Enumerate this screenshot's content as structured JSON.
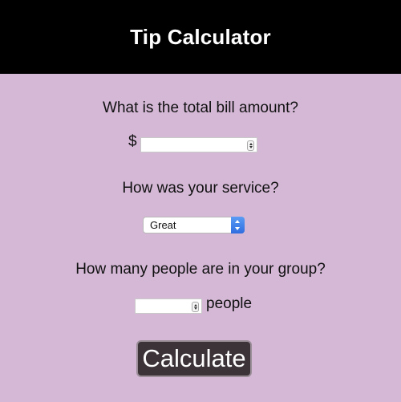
{
  "header": {
    "title": "Tip Calculator"
  },
  "bill": {
    "question": "What is the total bill amount?",
    "currency_symbol": "$",
    "value": ""
  },
  "service": {
    "question": "How was your service?",
    "selected": "Great"
  },
  "people": {
    "question": "How many people are in your group?",
    "value": "",
    "suffix": "people"
  },
  "calculate_button": {
    "label": "Calculate"
  },
  "colors": {
    "background": "#d4b8d6",
    "header_bg": "#000000",
    "button_bg": "#3b3338",
    "select_accent": "#2f6de0"
  }
}
